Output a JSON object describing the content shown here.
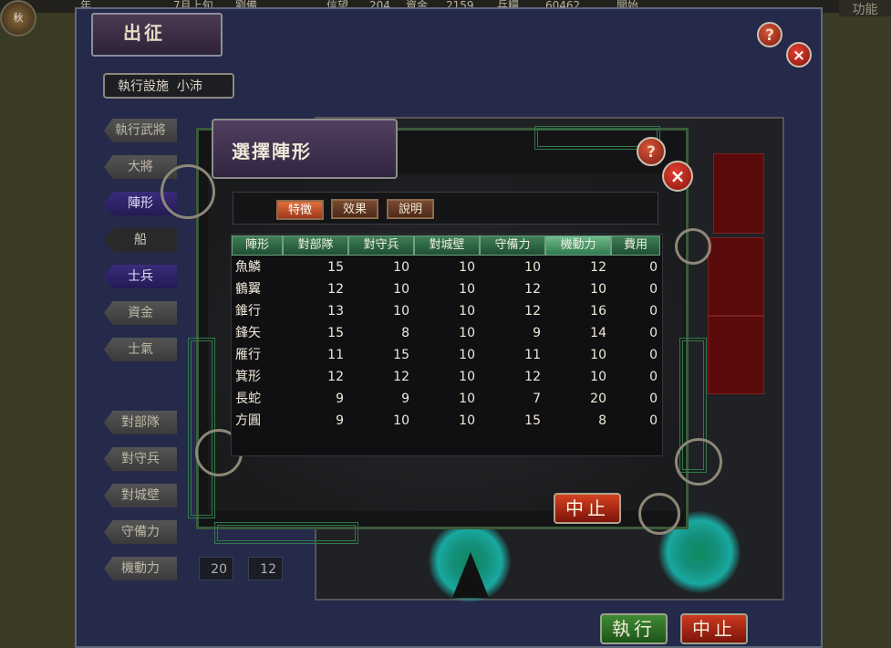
{
  "topbar": {
    "season": "秋",
    "segments": [
      "年",
      "7月上旬",
      "劉備",
      "信望",
      "204",
      "資金",
      "2159",
      "兵糧",
      "60462",
      "開始"
    ],
    "function_button": "功能"
  },
  "outer": {
    "title": "出征",
    "help_icon": "?",
    "close_icon": "×",
    "facility_label": "執行設施",
    "facility_value": "小沛",
    "side_buttons": [
      "執行武將",
      "大將",
      "陣形",
      "船",
      "士兵",
      "資金",
      "士氣"
    ],
    "stat_buttons": [
      "對部隊",
      "對守兵",
      "對城壁",
      "守備力",
      "機動力"
    ],
    "mobility_values": [
      "20",
      "12"
    ],
    "execute_button": "執行",
    "cancel_button": "中止",
    "side_labels_overlap": [
      "・",
      "・"
    ]
  },
  "dialog": {
    "title": "選擇陣形",
    "help_icon": "?",
    "close_icon": "×",
    "tabs": [
      "特徵",
      "效果",
      "說明"
    ],
    "active_tab": "特徵",
    "cancel_button": "中止",
    "columns": [
      "陣形",
      "對部隊",
      "對守兵",
      "對城壁",
      "守備力",
      "機動力",
      "費用"
    ],
    "selected_column": "機動力",
    "rows": [
      [
        "魚鱗",
        "15",
        "10",
        "10",
        "10",
        "12",
        "0"
      ],
      [
        "鶴翼",
        "12",
        "10",
        "10",
        "12",
        "10",
        "0"
      ],
      [
        "錐行",
        "13",
        "10",
        "10",
        "12",
        "16",
        "0"
      ],
      [
        "鋒矢",
        "15",
        "8",
        "10",
        "9",
        "14",
        "0"
      ],
      [
        "雁行",
        "11",
        "15",
        "10",
        "11",
        "10",
        "0"
      ],
      [
        "箕形",
        "12",
        "12",
        "10",
        "12",
        "10",
        "0"
      ],
      [
        "長蛇",
        "9",
        "9",
        "10",
        "7",
        "20",
        "0"
      ],
      [
        "方圓",
        "9",
        "10",
        "10",
        "15",
        "8",
        "0"
      ]
    ]
  },
  "colors": {
    "header_green": "#2f7a4e",
    "cancel_red": "#b02a12",
    "execute_green": "#2e7a28",
    "active_tab": "#d0602f"
  }
}
